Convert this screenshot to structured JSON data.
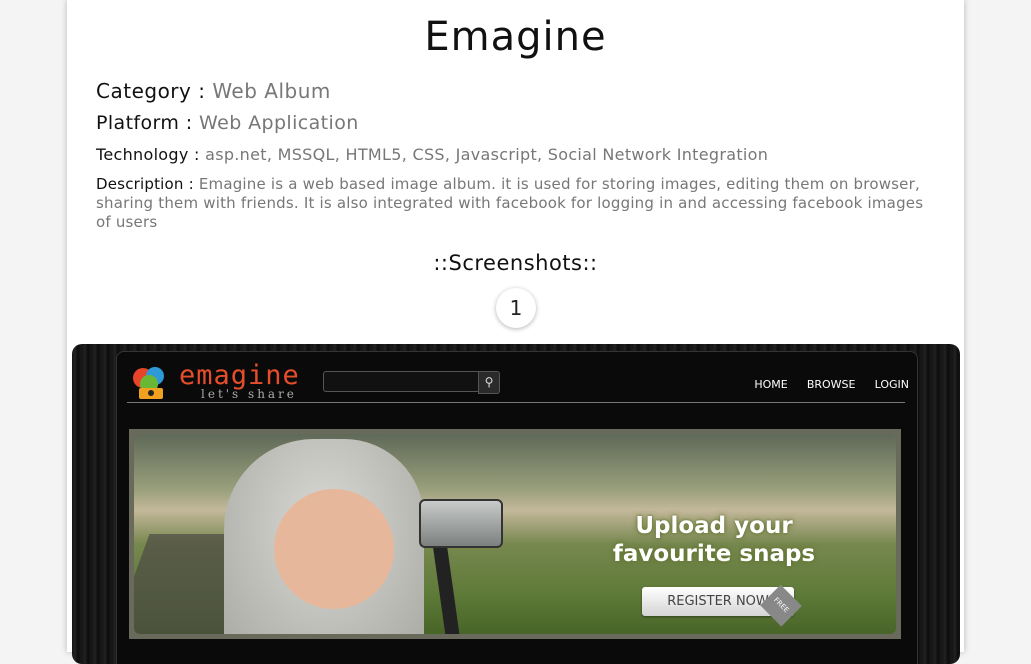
{
  "project": {
    "title": "Emagine",
    "category_label": "Category :",
    "category_value": "Web Album",
    "platform_label": "Platform :",
    "platform_value": "Web Application",
    "technology_label": "Technology :",
    "technology_value": "asp.net, MSSQL, HTML5, CSS, Javascript, Social Network Integration",
    "description_label": "Description :",
    "description_value": "Emagine is a web based image album. it is used for storing images, editing them on browser, sharing them with friends. It is also integrated with facebook for logging in and accessing facebook images of users",
    "screenshots_heading": "::Screenshots::",
    "pager_current": "1"
  },
  "screenshot": {
    "logo_word": "emagine",
    "logo_tagline": "let's share",
    "nav": [
      "HOME",
      "BROWSE",
      "LOGIN"
    ],
    "banner_line1": "Upload your",
    "banner_line2": "favourite snaps",
    "register_label": "REGISTER NOW",
    "free_badge": "FREE"
  }
}
